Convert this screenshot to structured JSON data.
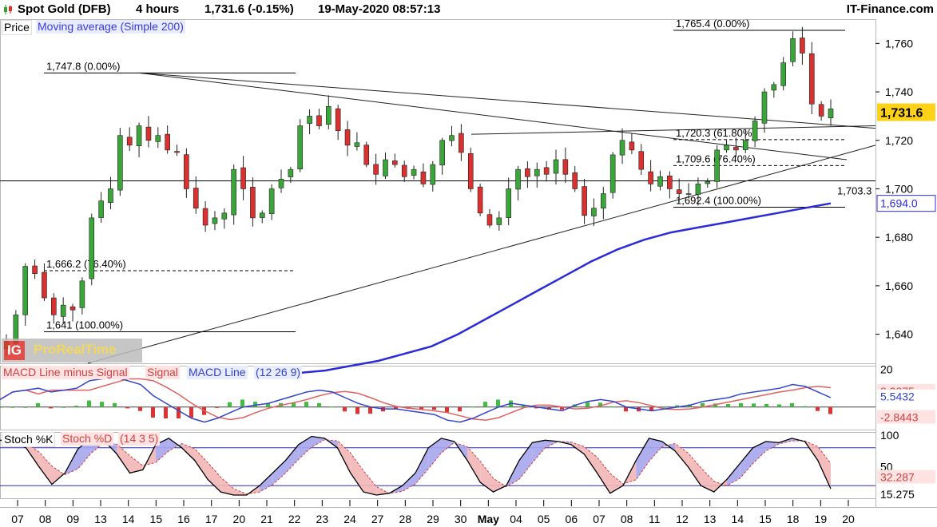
{
  "header": {
    "symbol": "Spot Gold (DFB)",
    "timeframe": "4 hours",
    "quote": "1,731.6 (-0.15%)",
    "datetime": "19-May-2020 08:57:13",
    "source": "IT-Finance.com"
  },
  "legend": {
    "price": "Price",
    "ma": "Moving average (Simple 200)",
    "macd_hist": "MACD Line minus Signal",
    "macd_signal": "Signal",
    "macd_line": "MACD Line",
    "macd_params": "(12 26 9)",
    "stoch_k": "Stoch %K",
    "stoch_d": "Stoch %D",
    "stoch_params": "(14 3 5)"
  },
  "branding": {
    "logo_text": "IG",
    "platform": "ProRealTime"
  },
  "colors": {
    "up": "#3aa63a",
    "down": "#d93030",
    "ma": "#2b2bd9",
    "price_tag_bg": "#ffd21a",
    "macd_line": "#3344cc",
    "macd_signal": "#e06060",
    "hist": "#44bb44",
    "hist_neg": "#dd3333"
  },
  "chart_data": [
    {
      "type": "candlestick",
      "title": "Spot Gold (DFB) 4 hours",
      "x_dates": [
        "07",
        "08",
        "09",
        "13",
        "14",
        "15",
        "16",
        "17",
        "20",
        "21",
        "22",
        "23",
        "24",
        "27",
        "28",
        "29",
        "30",
        "May",
        "04",
        "05",
        "06",
        "07",
        "08",
        "11",
        "12",
        "13",
        "14",
        "15",
        "18",
        "19",
        "20"
      ],
      "ylim": [
        1628,
        1770
      ],
      "y_ticks": [
        "1,640",
        "1,660",
        "1,680",
        "1,700",
        "1,720",
        "1,740",
        "1,760"
      ],
      "y_tick_values": [
        1640,
        1660,
        1680,
        1700,
        1720,
        1740,
        1760
      ],
      "last_price": 1731.6,
      "last_price_label": "1,731.6",
      "ma200_last": 1694.0,
      "ma200_label": "1,694.0",
      "close_path": [
        1637,
        1648,
        1668,
        1665,
        1655,
        1648,
        1652,
        1650,
        1662,
        1688,
        1695,
        1700,
        1722,
        1718,
        1726,
        1720,
        1722,
        1716,
        1715,
        1700,
        1692,
        1685,
        1688,
        1690,
        1708,
        1700,
        1688,
        1690,
        1700,
        1704,
        1708,
        1726,
        1730,
        1726,
        1734,
        1724,
        1718,
        1719,
        1710,
        1706,
        1712,
        1710,
        1705,
        1708,
        1702,
        1710,
        1720,
        1722,
        1715,
        1700,
        1690,
        1685,
        1688,
        1700,
        1708,
        1705,
        1708,
        1706,
        1712,
        1706,
        1700,
        1689,
        1692,
        1698,
        1714,
        1720,
        1716,
        1708,
        1702,
        1705,
        1700,
        1698,
        1698,
        1702,
        1703,
        1716,
        1718,
        1716,
        1720,
        1728,
        1740,
        1743,
        1752,
        1762,
        1756,
        1735,
        1730,
        1733
      ],
      "ma200_path": [
        1623,
        1624,
        1625,
        1627,
        1629,
        1632,
        1635,
        1640,
        1646,
        1652,
        1658,
        1664,
        1670,
        1675,
        1679,
        1682,
        1684,
        1686,
        1688,
        1690,
        1692,
        1694
      ],
      "annotations": [
        {
          "label": "1,747.8 (0.00%)",
          "value": 1747.8
        },
        {
          "label": "1,666.2 (76.40%)",
          "value": 1666.2
        },
        {
          "label": "1,641 (100.00%)",
          "value": 1641
        },
        {
          "label": "1,765.4 (0.00%)",
          "value": 1765.4
        },
        {
          "label": "1,720.3 (61.80%)",
          "value": 1720.3
        },
        {
          "label": "1,709.6 (76.40%)",
          "value": 1709.6
        },
        {
          "label": "1,692.4 (100.00%)",
          "value": 1692.4
        },
        {
          "label": "1,703.3",
          "value": 1703.3
        }
      ]
    },
    {
      "type": "macd",
      "params": "12 26 9",
      "y_ticks": [
        "20"
      ],
      "y_tick_values": [
        20
      ],
      "ylim": [
        -12,
        22
      ],
      "macd_last": 5.5432,
      "macd_label": "5.5432",
      "signal_last": 8.3875,
      "signal_label": "8.3875",
      "hist_last": -2.8443,
      "hist_label": "-2.8443",
      "macd_path": [
        4,
        8,
        9,
        10,
        8,
        9,
        10,
        14,
        15,
        16,
        14,
        12,
        6,
        2,
        -2,
        -6,
        -8,
        -6,
        -3,
        0,
        1,
        2,
        4,
        6,
        8,
        9,
        8,
        5,
        2,
        0,
        -1,
        -1,
        -2,
        -3,
        -4,
        -7,
        -8,
        -6,
        -3,
        0,
        2,
        1,
        0,
        -1,
        -2,
        1,
        3,
        4,
        3,
        0,
        -1,
        -2,
        -1,
        0,
        1,
        3,
        4,
        5,
        7,
        8,
        9,
        10,
        12,
        11,
        8,
        5
      ]
    },
    {
      "type": "stochastic",
      "params": "14 3 5",
      "y_ticks": [
        "100",
        "50"
      ],
      "y_tick_values": [
        100,
        50
      ],
      "ylim": [
        0,
        105
      ],
      "k_last": 15.275,
      "k_label": "15.275",
      "d_last": 32.287,
      "d_label": "32.287",
      "k_path": [
        92,
        90,
        80,
        50,
        22,
        40,
        78,
        95,
        92,
        70,
        40,
        45,
        85,
        95,
        80,
        60,
        30,
        10,
        5,
        5,
        20,
        40,
        60,
        85,
        98,
        95,
        80,
        40,
        10,
        5,
        8,
        20,
        40,
        80,
        95,
        90,
        60,
        25,
        10,
        20,
        60,
        88,
        92,
        90,
        85,
        70,
        40,
        8,
        20,
        60,
        95,
        90,
        75,
        50,
        20,
        10,
        30,
        55,
        80,
        90,
        88,
        95,
        90,
        60,
        15
      ]
    }
  ]
}
